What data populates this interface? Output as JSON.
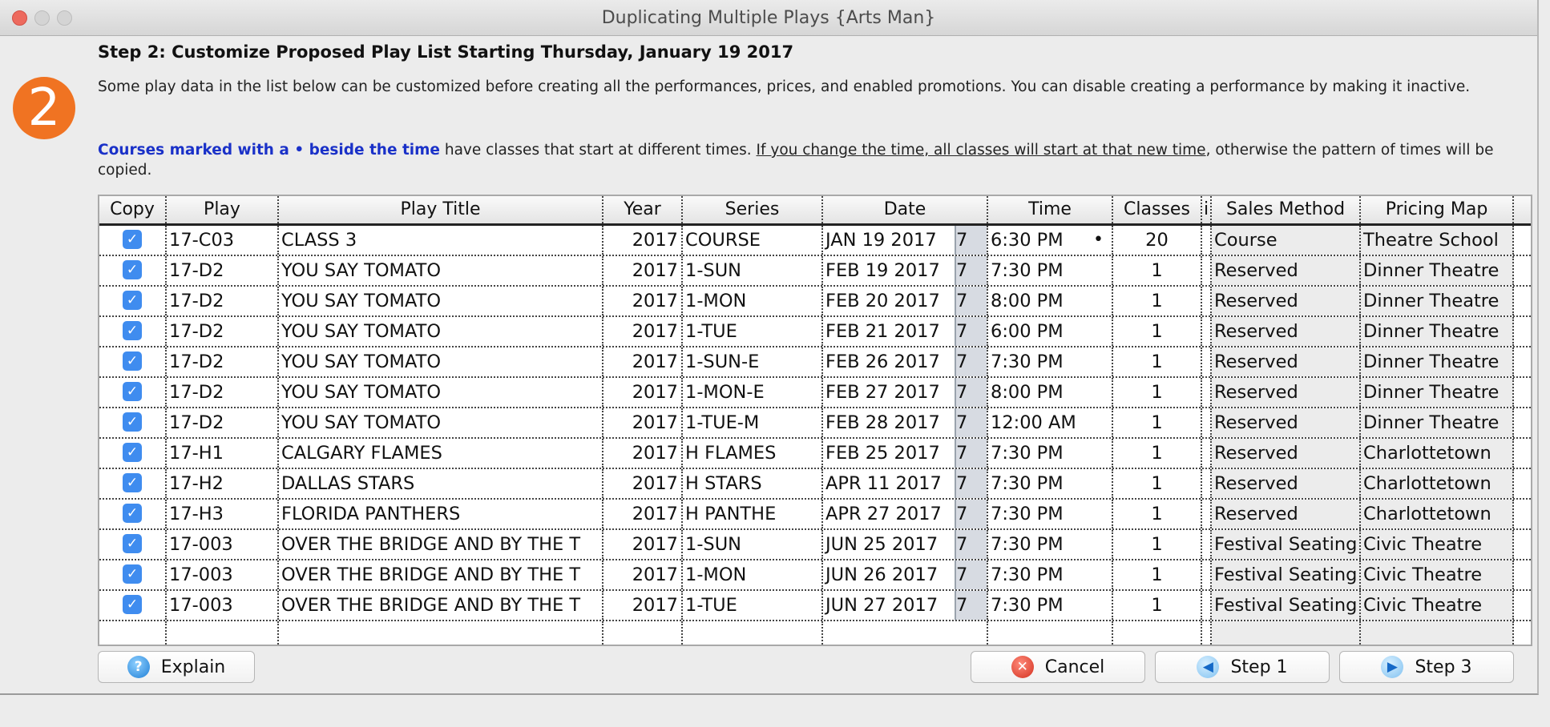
{
  "window": {
    "title": "Duplicating Multiple Plays {Arts Man}"
  },
  "badge": {
    "number": "2",
    "color": "#f07322"
  },
  "step": {
    "title": "Step 2: Customize Proposed Play List Starting Thursday, January 19 2017",
    "description": "Some play data in the list below can be customized before creating all the performances, prices, and enabled promotions.  You can disable creating a performance by making it inactive.",
    "note_blue": "Courses marked with a • beside the time",
    "note_mid": " have classes that start at different times. ",
    "note_underline": "If you change the time, all classes will start at that new time",
    "note_end": ", otherwise the pattern of times will be copied."
  },
  "table": {
    "columns": [
      "Copy",
      "Play",
      "Play Title",
      "Year",
      "Series",
      "Date",
      "Time",
      "Classes",
      "i",
      "Sales Method",
      "Pricing Map"
    ],
    "rows": [
      {
        "copy": true,
        "play": "17-C03",
        "title": "CLASS 3",
        "year": "2017",
        "series": "COURSE",
        "date": "JAN 19 2017",
        "time": "6:30 PM",
        "dot": "•",
        "classes": "20",
        "sales": "Course",
        "map": "Theatre School"
      },
      {
        "copy": true,
        "play": "17-D2",
        "title": "YOU SAY TOMATO",
        "year": "2017",
        "series": "1-SUN",
        "date": "FEB 19 2017",
        "time": "7:30 PM",
        "dot": "",
        "classes": "1",
        "sales": "Reserved",
        "map": "Dinner Theatre"
      },
      {
        "copy": true,
        "play": "17-D2",
        "title": "YOU SAY TOMATO",
        "year": "2017",
        "series": "1-MON",
        "date": "FEB 20 2017",
        "time": "8:00 PM",
        "dot": "",
        "classes": "1",
        "sales": "Reserved",
        "map": "Dinner Theatre"
      },
      {
        "copy": true,
        "play": "17-D2",
        "title": "YOU SAY TOMATO",
        "year": "2017",
        "series": "1-TUE",
        "date": "FEB 21 2017",
        "time": "6:00 PM",
        "dot": "",
        "classes": "1",
        "sales": "Reserved",
        "map": "Dinner Theatre"
      },
      {
        "copy": true,
        "play": "17-D2",
        "title": "YOU SAY TOMATO",
        "year": "2017",
        "series": "1-SUN-E",
        "date": "FEB 26 2017",
        "time": "7:30 PM",
        "dot": "",
        "classes": "1",
        "sales": "Reserved",
        "map": "Dinner Theatre"
      },
      {
        "copy": true,
        "play": "17-D2",
        "title": "YOU SAY TOMATO",
        "year": "2017",
        "series": "1-MON-E",
        "date": "FEB 27 2017",
        "time": "8:00 PM",
        "dot": "",
        "classes": "1",
        "sales": "Reserved",
        "map": "Dinner Theatre"
      },
      {
        "copy": true,
        "play": "17-D2",
        "title": "YOU SAY TOMATO",
        "year": "2017",
        "series": "1-TUE-M",
        "date": "FEB 28 2017",
        "time": "12:00 AM",
        "dot": "",
        "classes": "1",
        "sales": "Reserved",
        "map": "Dinner Theatre"
      },
      {
        "copy": true,
        "play": "17-H1",
        "title": "CALGARY FLAMES",
        "year": "2017",
        "series": "H FLAMES",
        "date": "FEB 25 2017",
        "time": "7:30 PM",
        "dot": "",
        "classes": "1",
        "sales": "Reserved",
        "map": "Charlottetown"
      },
      {
        "copy": true,
        "play": "17-H2",
        "title": "DALLAS STARS",
        "year": "2017",
        "series": "H STARS",
        "date": "APR 11 2017",
        "time": "7:30 PM",
        "dot": "",
        "classes": "1",
        "sales": "Reserved",
        "map": "Charlottetown"
      },
      {
        "copy": true,
        "play": "17-H3",
        "title": "FLORIDA PANTHERS",
        "year": "2017",
        "series": "H PANTHE",
        "date": "APR 27 2017",
        "time": "7:30 PM",
        "dot": "",
        "classes": "1",
        "sales": "Reserved",
        "map": "Charlottetown"
      },
      {
        "copy": true,
        "play": "17-003",
        "title": "OVER THE BRIDGE AND BY THE T",
        "year": "2017",
        "series": "1-SUN",
        "date": "JUN 25 2017",
        "time": "7:30 PM",
        "dot": "",
        "classes": "1",
        "sales": "Festival Seating",
        "map": "Civic Theatre"
      },
      {
        "copy": true,
        "play": "17-003",
        "title": "OVER THE BRIDGE AND BY THE T",
        "year": "2017",
        "series": "1-MON",
        "date": "JUN 26 2017",
        "time": "7:30 PM",
        "dot": "",
        "classes": "1",
        "sales": "Festival Seating",
        "map": "Civic Theatre"
      },
      {
        "copy": true,
        "play": "17-003",
        "title": "OVER THE BRIDGE AND BY THE T",
        "year": "2017",
        "series": "1-TUE",
        "date": "JUN 27 2017",
        "time": "7:30 PM",
        "dot": "",
        "classes": "1",
        "sales": "Festival Seating",
        "map": "Civic Theatre"
      }
    ]
  },
  "buttons": {
    "explain": "Explain",
    "cancel": "Cancel",
    "step1": "Step 1",
    "step3": "Step 3"
  },
  "icons": {
    "checkbox": "✓",
    "calendar": "7",
    "help": "?",
    "cancel": "✕",
    "prev": "◀",
    "next": "▶"
  }
}
